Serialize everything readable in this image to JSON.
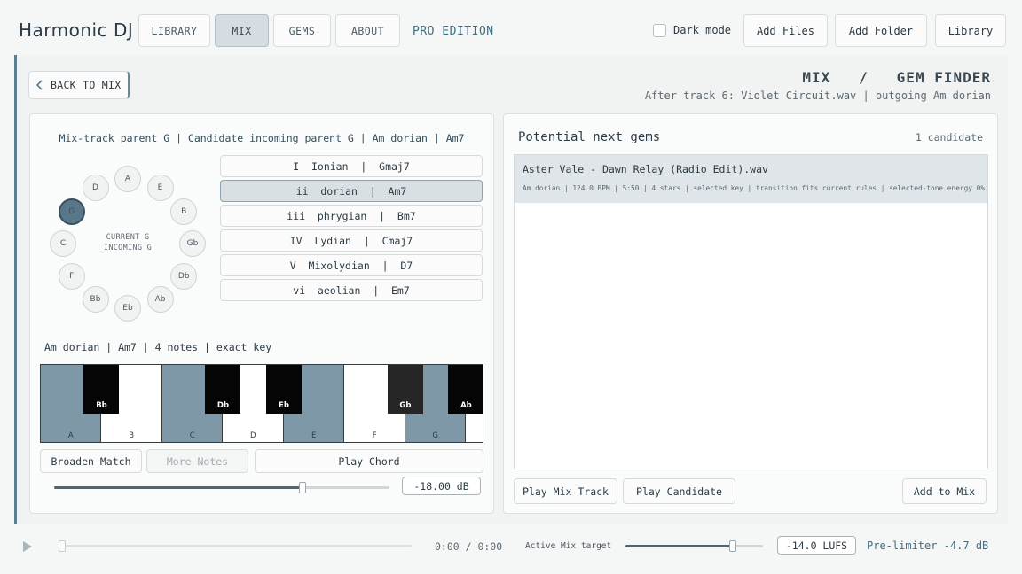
{
  "app": {
    "brand": "Harmonic DJ",
    "edition": "PRO EDITION"
  },
  "nav": {
    "tabs": [
      {
        "label": "LIBRARY",
        "active": false
      },
      {
        "label": "MIX",
        "active": true
      },
      {
        "label": "GEMS",
        "active": false
      },
      {
        "label": "ABOUT",
        "active": false
      }
    ]
  },
  "toolbar": {
    "dark_mode_label": "Dark mode",
    "dark_mode_checked": false,
    "add_files": "Add Files",
    "add_folder": "Add Folder",
    "library": "Library"
  },
  "page": {
    "back_label": "BACK TO MIX",
    "title": "MIX   /   GEM FINDER",
    "subtitle": "After track 6: Violet Circuit.wav | outgoing Am dorian"
  },
  "left": {
    "heading": "Mix-track parent G | Candidate incoming parent G | Am dorian | Am7",
    "wheel": {
      "notes": [
        "A",
        "E",
        "B",
        "Gb",
        "Db",
        "Ab",
        "Eb",
        "Bb",
        "F",
        "C",
        "G",
        "D"
      ],
      "selected": "G",
      "center_line1": "CURRENT G",
      "center_line2": "INCOMING G"
    },
    "modes": [
      {
        "label": "I  Ionian  |  Gmaj7",
        "active": false
      },
      {
        "label": "ii  dorian  |  Am7",
        "active": true
      },
      {
        "label": "iii  phrygian  |  Bm7",
        "active": false
      },
      {
        "label": "IV  Lydian  |  Cmaj7",
        "active": false
      },
      {
        "label": "V  Mixolydian  |  D7",
        "active": false
      },
      {
        "label": "vi  aeolian  |  Em7",
        "active": false
      }
    ],
    "scale_info": "Am dorian | Am7 | 4 notes | exact key",
    "piano": {
      "white_keys": [
        {
          "note": "A",
          "on": true
        },
        {
          "note": "B",
          "on": false
        },
        {
          "note": "C",
          "on": true
        },
        {
          "note": "D",
          "on": false
        },
        {
          "note": "E",
          "on": true
        },
        {
          "note": "F",
          "on": false
        },
        {
          "note": "G",
          "on": true
        }
      ],
      "black_keys": [
        {
          "note": "Bb",
          "muted": false
        },
        {
          "note": "Db",
          "muted": false
        },
        {
          "note": "Eb",
          "muted": false
        },
        {
          "note": "Gb",
          "muted": true
        },
        {
          "note": "Ab",
          "muted": false
        }
      ]
    },
    "buttons": {
      "broaden": "Broaden Match",
      "more_notes": "More Notes",
      "play_chord": "Play Chord"
    },
    "volume": {
      "value_label": "-18.00 dB",
      "fraction": 0.74
    }
  },
  "right": {
    "title": "Potential next gems",
    "count": "1 candidate",
    "candidates": [
      {
        "title": "Aster Vale - Dawn Relay (Radio Edit).wav",
        "meta": "Am dorian | 124.0 BPM | 5:50 | 4 stars | selected key | transition fits current rules | selected-tone energy 0%"
      }
    ],
    "buttons": {
      "play_mix": "Play Mix Track",
      "play_candidate": "Play Candidate",
      "add_to_mix": "Add to Mix"
    }
  },
  "player": {
    "time": "0:00 / 0:00",
    "progress": 0,
    "target_label": "Active Mix target",
    "target_fraction": 0.78,
    "lufs": "-14.0 LUFS",
    "pre_limiter": "Pre-limiter -4.7 dB"
  },
  "colors": {
    "accent": "#5d7f91",
    "active_key": "#7f98a8",
    "text_accent": "#3e6e86"
  }
}
